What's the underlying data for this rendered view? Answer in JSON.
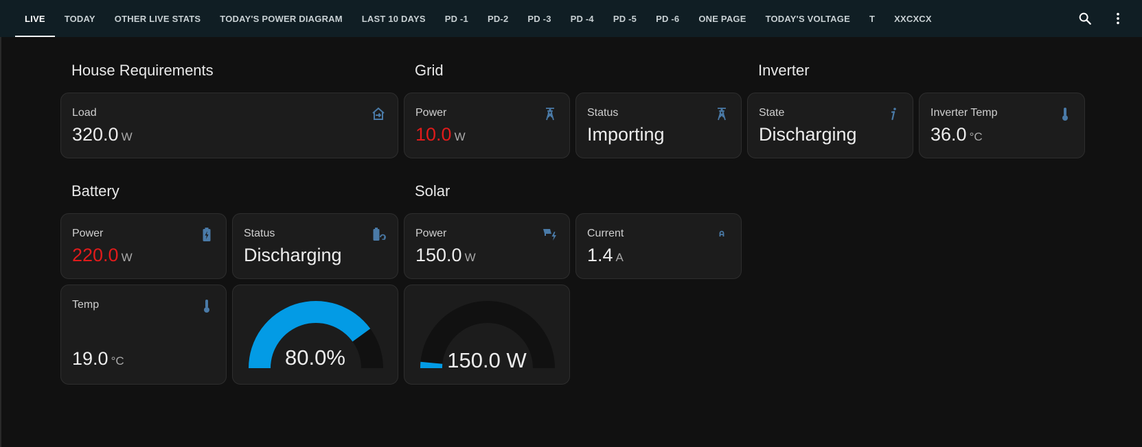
{
  "tabs": [
    "LIVE",
    "TODAY",
    "OTHER LIVE STATS",
    "TODAY'S POWER DIAGRAM",
    "LAST 10 DAYS",
    "PD -1",
    "PD-2",
    "PD -3",
    "PD -4",
    "PD -5",
    "PD -6",
    "ONE PAGE",
    "TODAY'S VOLTAGE",
    "T",
    "XXCXCX"
  ],
  "active_tab": "LIVE",
  "icons": {
    "search": "search-icon",
    "more": "more-vert-icon"
  },
  "colors": {
    "accent_blue": "#039be5",
    "value_red": "#e01b1b",
    "icon_blue": "#44739e"
  },
  "sections": {
    "house": "House Requirements",
    "grid": "Grid",
    "inverter": "Inverter",
    "battery": "Battery",
    "solar": "Solar"
  },
  "cards": {
    "load": {
      "name": "Load",
      "value": "320.0",
      "unit": "W",
      "icon": "home-export-icon"
    },
    "grid_power": {
      "name": "Power",
      "value": "10.0",
      "unit": "W",
      "icon": "transmission-tower-icon"
    },
    "grid_status": {
      "name": "Status",
      "value": "Importing",
      "icon": "transmission-tower-icon"
    },
    "inverter_state": {
      "name": "State",
      "value": "Discharging",
      "icon": "info-icon"
    },
    "inverter_temp": {
      "name": "Inverter Temp",
      "value": "36.0",
      "unit": "°C",
      "icon": "thermometer-icon"
    },
    "battery_power": {
      "name": "Power",
      "value": "220.0",
      "unit": "W",
      "icon": "battery-charging-icon"
    },
    "battery_status": {
      "name": "Status",
      "value": "Discharging",
      "icon": "battery-sync-icon"
    },
    "solar_power": {
      "name": "Power",
      "value": "150.0",
      "unit": "W",
      "icon": "solar-power-icon"
    },
    "solar_current": {
      "name": "Current",
      "value": "1.4",
      "unit": "A",
      "icon": "current-a-icon"
    },
    "battery_temp": {
      "name": "Temp",
      "value": "19.0",
      "unit": "°C",
      "icon": "thermometer-icon"
    }
  },
  "gauges": {
    "battery_soc": {
      "label": "80.0%",
      "fraction": 0.8
    },
    "solar_gauge": {
      "label": "150.0 W",
      "fraction": 0.03
    }
  }
}
